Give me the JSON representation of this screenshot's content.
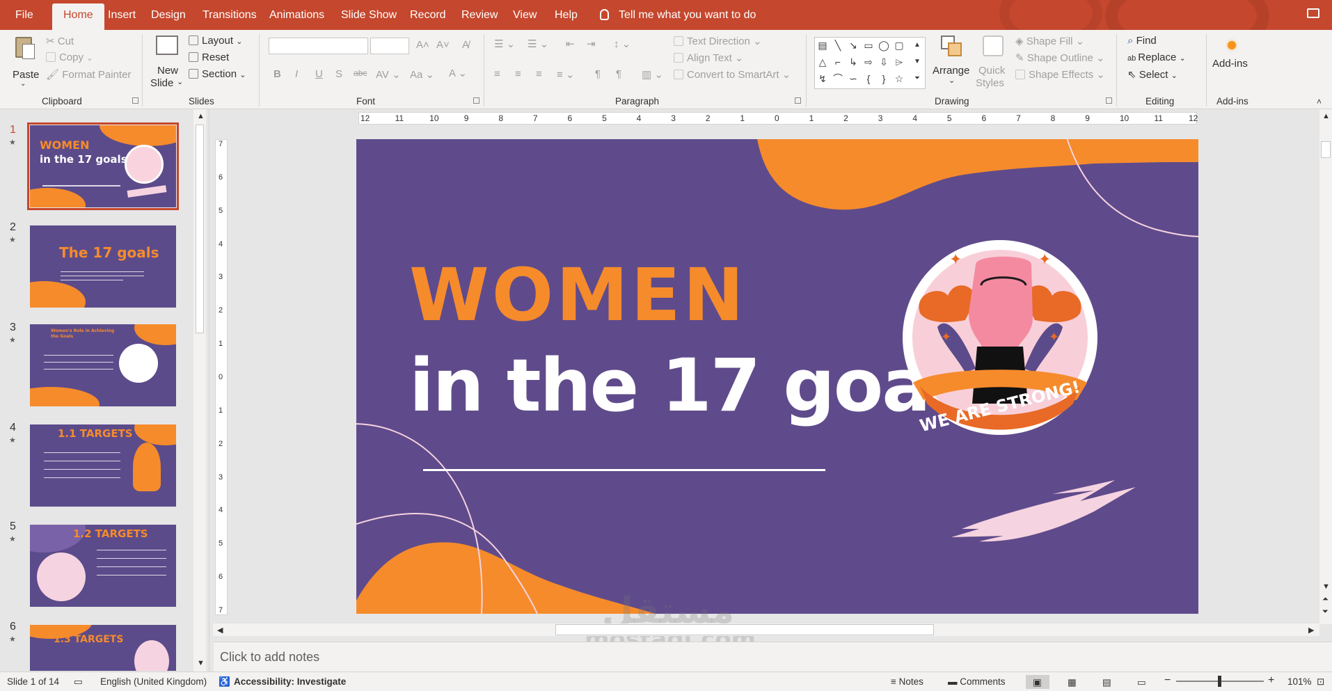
{
  "tabs": [
    "File",
    "Home",
    "Insert",
    "Design",
    "Transitions",
    "Animations",
    "Slide Show",
    "Record",
    "Review",
    "View",
    "Help"
  ],
  "tell_me": "Tell me what you want to do",
  "ribbon": {
    "clipboard": {
      "paste": "Paste",
      "cut": "Cut",
      "copy": "Copy",
      "format_painter": "Format Painter",
      "label": "Clipboard"
    },
    "slides": {
      "new_slide_1": "New",
      "new_slide_2": "Slide",
      "layout": "Layout",
      "reset": "Reset",
      "section": "Section",
      "label": "Slides"
    },
    "font": {
      "label": "Font"
    },
    "paragraph": {
      "text_direction": "Text Direction",
      "align_text": "Align Text",
      "convert_smartart": "Convert to SmartArt",
      "label": "Paragraph"
    },
    "drawing": {
      "arrange": "Arrange",
      "quick_styles_1": "Quick",
      "quick_styles_2": "Styles",
      "shape_fill": "Shape Fill",
      "shape_outline": "Shape Outline",
      "shape_effects": "Shape Effects",
      "label": "Drawing"
    },
    "editing": {
      "find": "Find",
      "replace": "Replace",
      "select": "Select",
      "label": "Editing"
    },
    "addins": {
      "button": "Add-ins",
      "label": "Add-ins"
    }
  },
  "thumbnails": [
    {
      "num": "1",
      "title_line1": "WOMEN",
      "title_line2": "in the 17 goals"
    },
    {
      "num": "2",
      "title": "The 17 goals"
    },
    {
      "num": "3",
      "title": "Women's Role in Achieving the Goals"
    },
    {
      "num": "4",
      "title": "1.1 TARGETS"
    },
    {
      "num": "5",
      "title": "1.2 TARGETS"
    },
    {
      "num": "6",
      "title": "1.3 TARGETS"
    }
  ],
  "ruler": {
    "h": [
      "12",
      "11",
      "10",
      "9",
      "8",
      "7",
      "6",
      "5",
      "4",
      "3",
      "2",
      "1",
      "0",
      "1",
      "2",
      "3",
      "4",
      "5",
      "6",
      "7",
      "8",
      "9",
      "10",
      "11",
      "12"
    ],
    "v": [
      "7",
      "6",
      "5",
      "4",
      "3",
      "2",
      "1",
      "0",
      "1",
      "2",
      "3",
      "4",
      "5",
      "6",
      "7"
    ]
  },
  "slide": {
    "title_line1": "WOMEN",
    "title_line2": "in the 17 goals",
    "badge_text": "WE ARE STRONG!"
  },
  "watermark": {
    "arabic": "مستقل",
    "latin": "mostaql.com"
  },
  "notes_placeholder": "Click to add notes",
  "status": {
    "slide_count": "Slide 1 of 14",
    "language": "English (United Kingdom)",
    "accessibility": "Accessibility: Investigate",
    "notes": "Notes",
    "comments": "Comments",
    "zoom": "101%"
  },
  "colors": {
    "accent": "#c5472d",
    "slide_bg": "#5f4b8b",
    "orange": "#f68b2c",
    "pink": "#f6d3e0"
  }
}
